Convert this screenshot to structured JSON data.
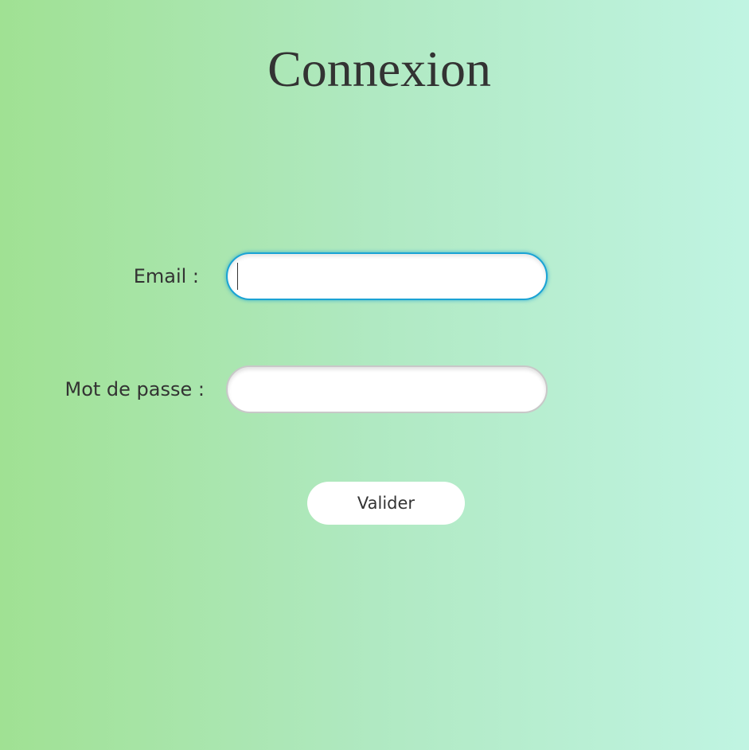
{
  "page": {
    "title": "Connexion"
  },
  "form": {
    "email": {
      "label": "Email :",
      "value": "",
      "placeholder": "",
      "focused": true
    },
    "password": {
      "label": "Mot de passe :",
      "value": "",
      "placeholder": ""
    },
    "submit_label": "Valider"
  },
  "colors": {
    "gradient_start": "#a0e193",
    "gradient_end": "#c0f4e2",
    "focus_border": "#1aa3d4",
    "text": "#333333"
  }
}
